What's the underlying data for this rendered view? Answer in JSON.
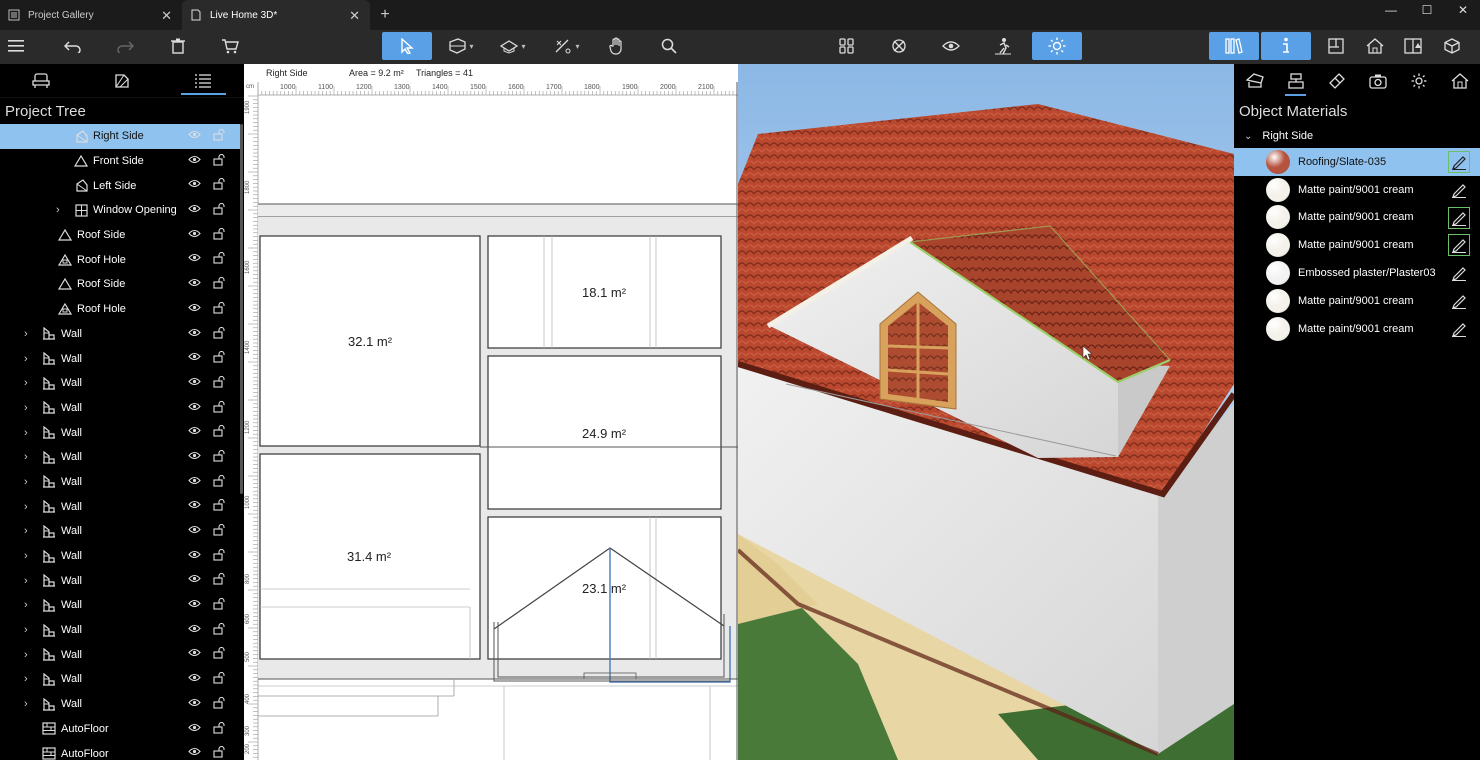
{
  "tabs": [
    {
      "label": "Project Gallery",
      "icon": "gallery-icon"
    },
    {
      "label": "Live Home 3D*",
      "icon": "document-icon"
    }
  ],
  "left_panel": {
    "title": "Project Tree",
    "items": [
      {
        "label": "Right Side",
        "icon": "roof-side-icon",
        "selected": true,
        "expandable": false,
        "indent": 2
      },
      {
        "label": "Front Side",
        "icon": "roof-front-icon",
        "selected": false,
        "expandable": false,
        "indent": 2
      },
      {
        "label": "Left Side",
        "icon": "roof-side-icon",
        "selected": false,
        "expandable": false,
        "indent": 2
      },
      {
        "label": "Window Opening",
        "icon": "window-icon",
        "selected": false,
        "expandable": true,
        "indent": 2
      },
      {
        "label": "Roof Side",
        "icon": "roof-front-icon",
        "selected": false,
        "expandable": false,
        "indent": 1
      },
      {
        "label": "Roof Hole",
        "icon": "roof-hole-icon",
        "selected": false,
        "expandable": false,
        "indent": 1
      },
      {
        "label": "Roof Side",
        "icon": "roof-front-icon",
        "selected": false,
        "expandable": false,
        "indent": 1
      },
      {
        "label": "Roof Hole",
        "icon": "roof-hole-icon",
        "selected": false,
        "expandable": false,
        "indent": 1
      },
      {
        "label": "Wall",
        "icon": "wall-icon",
        "selected": false,
        "expandable": true,
        "indent": 0
      },
      {
        "label": "Wall",
        "icon": "wall-icon",
        "selected": false,
        "expandable": true,
        "indent": 0
      },
      {
        "label": "Wall",
        "icon": "wall-icon",
        "selected": false,
        "expandable": true,
        "indent": 0
      },
      {
        "label": "Wall",
        "icon": "wall-icon",
        "selected": false,
        "expandable": true,
        "indent": 0
      },
      {
        "label": "Wall",
        "icon": "wall-icon",
        "selected": false,
        "expandable": true,
        "indent": 0
      },
      {
        "label": "Wall",
        "icon": "wall-icon",
        "selected": false,
        "expandable": true,
        "indent": 0
      },
      {
        "label": "Wall",
        "icon": "wall-icon",
        "selected": false,
        "expandable": true,
        "indent": 0
      },
      {
        "label": "Wall",
        "icon": "wall-icon",
        "selected": false,
        "expandable": true,
        "indent": 0
      },
      {
        "label": "Wall",
        "icon": "wall-icon",
        "selected": false,
        "expandable": true,
        "indent": 0
      },
      {
        "label": "Wall",
        "icon": "wall-icon",
        "selected": false,
        "expandable": true,
        "indent": 0
      },
      {
        "label": "Wall",
        "icon": "wall-icon",
        "selected": false,
        "expandable": true,
        "indent": 0
      },
      {
        "label": "Wall",
        "icon": "wall-icon",
        "selected": false,
        "expandable": true,
        "indent": 0
      },
      {
        "label": "Wall",
        "icon": "wall-icon",
        "selected": false,
        "expandable": true,
        "indent": 0
      },
      {
        "label": "Wall",
        "icon": "wall-icon",
        "selected": false,
        "expandable": true,
        "indent": 0
      },
      {
        "label": "Wall",
        "icon": "wall-icon",
        "selected": false,
        "expandable": true,
        "indent": 0
      },
      {
        "label": "Wall",
        "icon": "wall-icon",
        "selected": false,
        "expandable": true,
        "indent": 0
      },
      {
        "label": "AutoFloor",
        "icon": "floor-icon",
        "selected": false,
        "expandable": false,
        "indent": 0
      },
      {
        "label": "AutoFloor",
        "icon": "floor-icon",
        "selected": false,
        "expandable": false,
        "indent": 0
      }
    ]
  },
  "plan": {
    "view_name": "Right Side",
    "area_text": "Area = 9.2 m²",
    "triangles_text": "Triangles = 41",
    "ruler_h": [
      "1000",
      "1100",
      "1200",
      "1300",
      "1400",
      "1500",
      "1600",
      "1700",
      "1800",
      "1900",
      "2000",
      "2100"
    ],
    "ruler_v": [
      "1900",
      "1800",
      "1600",
      "1400",
      "1200",
      "1000",
      "800",
      "600",
      "500",
      "400",
      "300",
      "200"
    ],
    "ruler_unit": "cm",
    "areas": [
      "32.1 m²",
      "18.1 m²",
      "24.9 m²",
      "31.4 m²",
      "23.1 m²"
    ]
  },
  "right_panel": {
    "title": "Object Materials",
    "group": "Right Side",
    "materials": [
      {
        "name": "Roofing/Slate-035",
        "color": "#b5533f",
        "selected": true,
        "boxed": true
      },
      {
        "name": "Matte paint/9001 cream",
        "color": "#f4f1ea",
        "selected": false,
        "boxed": false
      },
      {
        "name": "Matte paint/9001 cream",
        "color": "#f4f1ea",
        "selected": false,
        "boxed": true
      },
      {
        "name": "Matte paint/9001 cream",
        "color": "#f4f1ea",
        "selected": false,
        "boxed": true
      },
      {
        "name": "Embossed plaster/Plaster03",
        "color": "#f2f2f2",
        "selected": false,
        "boxed": false
      },
      {
        "name": "Matte paint/9001 cream",
        "color": "#f4f1ea",
        "selected": false,
        "boxed": false
      },
      {
        "name": "Matte paint/9001 cream",
        "color": "#f4f1ea",
        "selected": false,
        "boxed": false
      }
    ]
  },
  "colors": {
    "accent": "#5aa0e6",
    "selection": "#8fc2ee",
    "roof": "#b9482f",
    "wall": "#e9e9e9"
  }
}
